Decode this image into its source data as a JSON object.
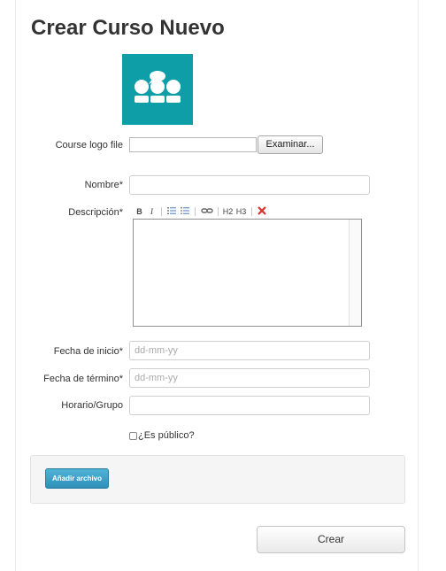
{
  "page": {
    "title": "Crear Curso Nuevo"
  },
  "logo": {
    "icon": "people-group-icon",
    "background": "#0e9ea8"
  },
  "form": {
    "logo_file": {
      "label": "Course logo file",
      "button": "Examinar..."
    },
    "name": {
      "label": "Nombre*",
      "value": ""
    },
    "description": {
      "label": "Descripción*",
      "toolbar": {
        "bold": "B",
        "italic": "I",
        "h2": "H2",
        "h3": "H3"
      }
    },
    "start_date": {
      "label": "Fecha de inicio*",
      "placeholder": "dd-mm-yy"
    },
    "end_date": {
      "label": "Fecha de término*",
      "placeholder": "dd-mm-yy"
    },
    "schedule": {
      "label": "Horario/Grupo",
      "value": ""
    },
    "public": {
      "label": "¿Es público?",
      "checked": false
    }
  },
  "attachments": {
    "button": "Añadir archivo"
  },
  "submit": {
    "label": "Crear"
  },
  "colors": {
    "accent": "#2f8fb8",
    "logo": "#0e9ea8"
  }
}
